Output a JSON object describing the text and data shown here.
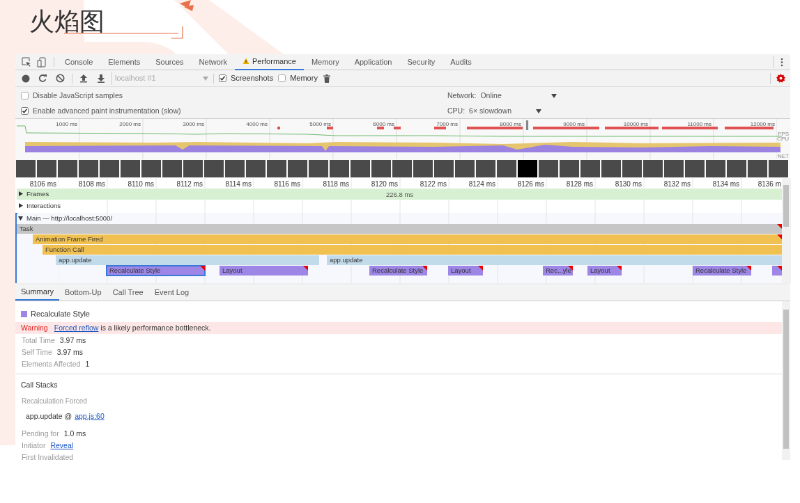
{
  "slide": {
    "title": "火焰图"
  },
  "devtools": {
    "tabs": [
      {
        "label": "Console",
        "selected": false,
        "warning": false
      },
      {
        "label": "Elements",
        "selected": false,
        "warning": false
      },
      {
        "label": "Sources",
        "selected": false,
        "warning": false
      },
      {
        "label": "Network",
        "selected": false,
        "warning": false
      },
      {
        "label": "Performance",
        "selected": true,
        "warning": true
      },
      {
        "label": "Memory",
        "selected": false,
        "warning": false
      },
      {
        "label": "Application",
        "selected": false,
        "warning": false
      },
      {
        "label": "Security",
        "selected": false,
        "warning": false
      },
      {
        "label": "Audits",
        "selected": false,
        "warning": false
      }
    ],
    "toolbar": {
      "profile_select": "localhost #1",
      "checkboxes": [
        {
          "label": "Screenshots",
          "checked": true
        },
        {
          "label": "Memory",
          "checked": false
        }
      ]
    },
    "settings": [
      {
        "label": "Disable JavaScript samples",
        "checked": false
      },
      {
        "label": "Enable advanced paint instrumentation (slow)",
        "checked": true
      }
    ],
    "throttling": [
      {
        "label": "Network:",
        "value": "Online"
      },
      {
        "label": "CPU:",
        "value": "6× slowdown"
      }
    ],
    "overview": {
      "ruler": [
        "1000 ms",
        "2000 ms",
        "3000 ms",
        "4000 ms",
        "5000 ms",
        "6000 ms",
        "7000 ms",
        "8000 ms",
        "9000 ms",
        "10000 ms",
        "11000 ms",
        "12000 ms"
      ],
      "track_labels": [
        "FPS",
        "CPU",
        "NET"
      ]
    },
    "timeline": {
      "ruler": [
        "8106 ms",
        "8108 ms",
        "8110 ms",
        "8112 ms",
        "8114 ms",
        "8116 ms",
        "8118 ms",
        "8120 ms",
        "8122 ms",
        "8124 ms",
        "8126 ms",
        "8128 ms",
        "8130 ms",
        "8132 ms",
        "8134 ms",
        "8136 m"
      ],
      "tracks": [
        {
          "label": "Frames",
          "expanded": false,
          "value": "226.8 ms"
        },
        {
          "label": "Interactions",
          "expanded": false
        },
        {
          "label": "Main — http://localhost:5000/",
          "expanded": true
        }
      ],
      "flame": [
        [
          {
            "label": "Task",
            "color": "#c6c6c6",
            "warning": true,
            "selected": false
          }
        ],
        [
          {
            "label": "Animation Frame Fired",
            "color": "#f0c150",
            "warning": true,
            "selected": false
          }
        ],
        [
          {
            "label": "Function Call",
            "color": "#f0c150",
            "warning": false,
            "selected": false
          }
        ],
        [
          {
            "label": "app.update",
            "color": "#c2dbea",
            "warning": false,
            "selected": false
          },
          {
            "label": "app.update",
            "color": "#c2dbea",
            "warning": false,
            "selected": false
          }
        ],
        [
          {
            "label": "Recalculate Style",
            "color": "#9d86e6",
            "warning": true,
            "selected": true
          },
          {
            "label": "Layout",
            "color": "#9d86e6",
            "warning": true,
            "selected": false
          },
          {
            "label": "Recalculate Style",
            "color": "#9d86e6",
            "warning": true,
            "selected": false
          },
          {
            "label": "Layout",
            "color": "#9d86e6",
            "warning": true,
            "selected": false
          },
          {
            "label": "Rec...yle",
            "color": "#9d86e6",
            "warning": true,
            "selected": false
          },
          {
            "label": "Layout",
            "color": "#9d86e6",
            "warning": true,
            "selected": false
          },
          {
            "label": "Recalculate Style",
            "color": "#9d86e6",
            "warning": true,
            "selected": false
          },
          {
            "color": "#9d86e6",
            "warning": true,
            "selected": false
          }
        ]
      ]
    },
    "details": {
      "tabs": [
        {
          "label": "Summary",
          "selected": true
        },
        {
          "label": "Bottom-Up",
          "selected": false
        },
        {
          "label": "Call Tree",
          "selected": false
        },
        {
          "label": "Event Log",
          "selected": false
        }
      ],
      "title": "Recalculate Style",
      "color": "#9d86e6",
      "warning": {
        "label": "Warning",
        "link": "Forced reflow",
        "text": "is a likely performance bottleneck."
      },
      "stats": [
        {
          "label": "Total Time",
          "value": "3.97 ms"
        },
        {
          "label": "Self Time",
          "value": "3.97 ms"
        },
        {
          "label": "Elements Affected",
          "value": "1"
        }
      ],
      "call_stacks": {
        "title": "Call Stacks",
        "subtitle": "Recalculation Forced",
        "function": "app.update @",
        "link": "app.js:60"
      },
      "more": [
        {
          "label": "Pending for",
          "value": "1.0 ms"
        },
        {
          "label": "Initiator",
          "link": "Reveal"
        },
        {
          "label": "First Invalidated"
        }
      ]
    }
  }
}
